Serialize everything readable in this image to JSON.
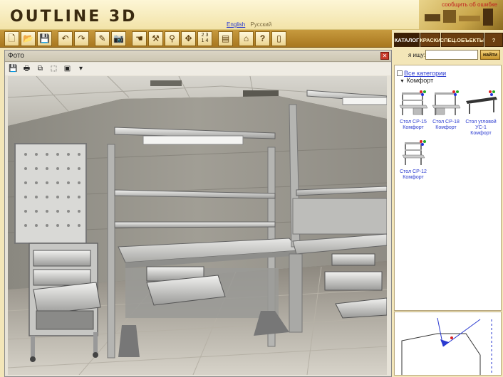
{
  "header": {
    "logo": "OUTLINE 3D",
    "languages": [
      {
        "label": "English",
        "active": true
      },
      {
        "label": "Русский",
        "active": false
      }
    ],
    "report_link": "сообщить об ошибке"
  },
  "toolbar": {
    "buttons": [
      {
        "name": "new-icon",
        "glyph": "🗋"
      },
      {
        "name": "open-folder-icon",
        "glyph": "📂"
      },
      {
        "name": "save-icon",
        "glyph": "💾"
      },
      {
        "name": "undo-icon",
        "glyph": "↶"
      },
      {
        "name": "redo-icon",
        "glyph": "↷"
      },
      {
        "name": "edit-icon",
        "glyph": "✎"
      },
      {
        "name": "camera-icon",
        "glyph": "📷"
      },
      {
        "name": "hand-icon",
        "glyph": "☚"
      },
      {
        "name": "tool-icon",
        "glyph": "⚒"
      },
      {
        "name": "pin-icon",
        "glyph": "⚲"
      },
      {
        "name": "move-icon",
        "glyph": "✥"
      }
    ],
    "view_numbers": {
      "top": "2 3",
      "bottom": "1 4"
    },
    "buttons_right": [
      {
        "name": "document-icon",
        "glyph": "▤"
      },
      {
        "name": "home-icon",
        "glyph": "⌂"
      },
      {
        "name": "help-icon",
        "glyph": "?"
      },
      {
        "name": "page-icon",
        "glyph": "▯"
      }
    ]
  },
  "tabs": [
    {
      "id": "tab-catalog",
      "label": "КАТАЛОГ",
      "active": true
    },
    {
      "id": "tab-paints",
      "label": "КРАСКИ",
      "active": false
    },
    {
      "id": "tab-special",
      "label": "СПЕЦ.ОБЪЕКТЫ",
      "active": false
    },
    {
      "id": "tab-help",
      "label": "?",
      "active": false
    }
  ],
  "photo": {
    "title": "Фото",
    "close_glyph": "✕",
    "tools": [
      {
        "name": "save-icon",
        "glyph": "💾"
      },
      {
        "name": "print-icon",
        "glyph": "🖶"
      },
      {
        "name": "fit-icon",
        "glyph": "⧉"
      },
      {
        "name": "cube-icon",
        "glyph": "⬚"
      },
      {
        "name": "camera-view-icon",
        "glyph": "▣"
      },
      {
        "name": "dropdown-arrow-icon",
        "glyph": "▾"
      }
    ]
  },
  "search": {
    "label": "я ищу:",
    "value": "",
    "placeholder": "",
    "button": "найти"
  },
  "catalog": {
    "all_categories": "Все категории",
    "group": "Комфорт",
    "products": [
      {
        "line1": "Стол СР-15",
        "line2": "Комфорт"
      },
      {
        "line1": "Стол СР-18",
        "line2": "Комфорт"
      },
      {
        "line1": "Стол угловой",
        "line2": "УС-1",
        "line3": "Комфорт"
      },
      {
        "line1": "Стол СР-12",
        "line2": "Комфорт"
      }
    ]
  }
}
